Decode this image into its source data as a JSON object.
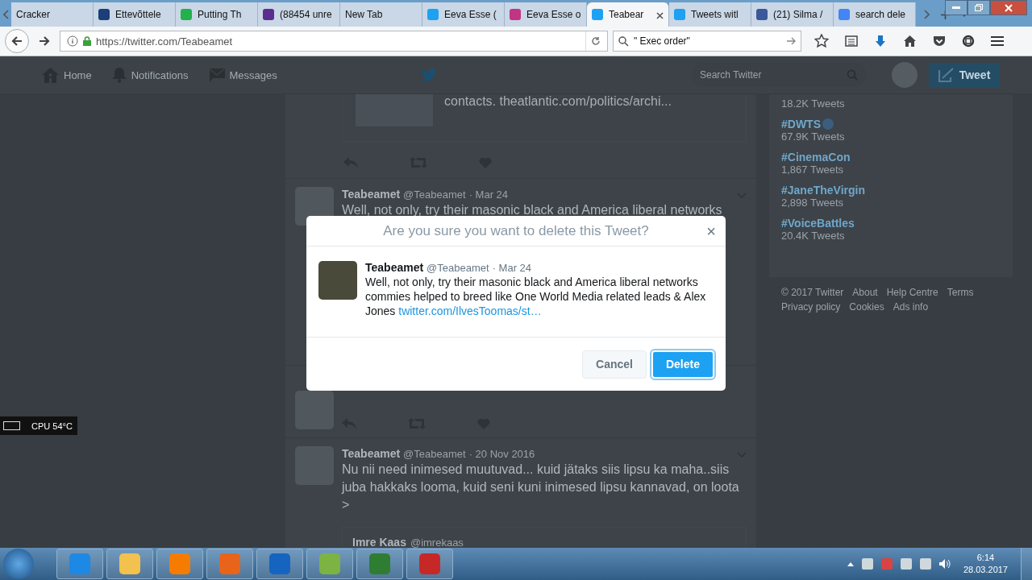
{
  "browser": {
    "tabs": [
      {
        "title": "Cracker",
        "selected": false
      },
      {
        "title": "Ettevõttele",
        "selected": false,
        "color": "#1c3f7a"
      },
      {
        "title": "Putting Th",
        "selected": false,
        "color": "#22b14c"
      },
      {
        "title": "(88454 unre",
        "selected": false,
        "color": "#5c2d91"
      },
      {
        "title": "New Tab",
        "selected": false
      },
      {
        "title": "Eeva Esse (",
        "selected": false,
        "color": "#1da1f2"
      },
      {
        "title": "Eeva Esse o",
        "selected": false,
        "color": "#c13584"
      },
      {
        "title": "Teabear",
        "selected": true,
        "color": "#1da1f2"
      },
      {
        "title": "Tweets witl",
        "selected": false,
        "color": "#1da1f2"
      },
      {
        "title": "(21) Silma /",
        "selected": false,
        "color": "#3b5998"
      },
      {
        "title": "search dele",
        "selected": false,
        "color": "#4285f4"
      }
    ],
    "url_host": "https://twitter.com/",
    "url_path": "Teabeamet",
    "search_value": "\" Exec order\""
  },
  "twitter_nav": {
    "items": [
      "Home",
      "Notifications",
      "Messages"
    ],
    "search": {
      "placeholder": "Search Twitter"
    },
    "tweet_button": "Tweet"
  },
  "timeline": {
    "snippet": "contacts. theatlantic.com/politics/archi...",
    "tweets": [
      {
        "name": "Teabeamet",
        "handle": "@Teabeamet",
        "date": "· Mar 24",
        "text": "Well, not only, try their masonic black and America liberal networks"
      },
      {
        "name": "Teabeamet",
        "handle": "@Teabeamet",
        "date": "· 20 Nov 2016",
        "text": "Nu nii need inimesed muutuvad... kuid jätaks siis lipsu ka maha..siis juba hakkaks looma, kuid seni kuni inimesed lipsu kannavad, on loota >",
        "quoted_name": "Imre Kaas",
        "quoted_handle": "@imrekaas"
      }
    ]
  },
  "trends": [
    {
      "count": "18.2K Tweets"
    },
    {
      "tag": "#DWTS",
      "count": "67.9K Tweets"
    },
    {
      "tag": "#CinemaCon",
      "count": "1,867 Tweets"
    },
    {
      "tag": "#JaneTheVirgin",
      "count": "2,898 Tweets"
    },
    {
      "tag": "#VoiceBattles",
      "count": "20.4K Tweets"
    }
  ],
  "footer_links": [
    "© 2017 Twitter",
    "About",
    "Help Centre",
    "Terms",
    "Privacy policy",
    "Cookies",
    "Ads info"
  ],
  "dialog": {
    "title": "Are you sure you want to delete this Tweet?",
    "close": "×",
    "name": "Teabeamet",
    "handle": "@Teabeamet",
    "date": "· Mar 24",
    "text": "Well, not only, try their masonic black and America liberal networks commies helped to breed like One World Media related leads & Alex Jones",
    "link": "twitter.com/IlvesToomas/st…",
    "buttons": [
      {
        "label": "Cancel",
        "kind": "secondary"
      },
      {
        "label": "Delete",
        "kind": "primary"
      }
    ]
  },
  "cpu_widget": "CPU 54°C",
  "taskbar": {
    "time": "6:14",
    "date": "28.03.2017"
  }
}
